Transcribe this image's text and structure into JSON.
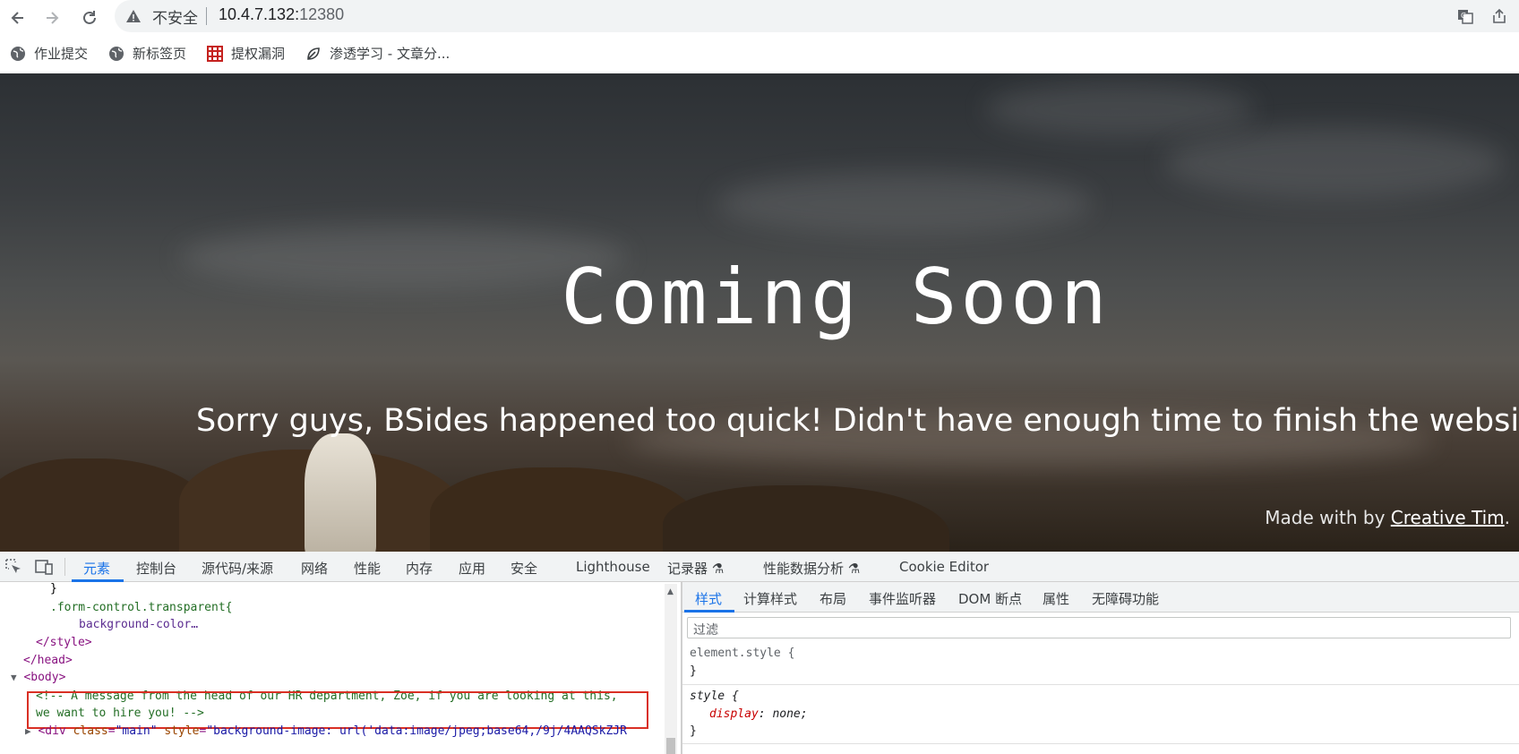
{
  "browser": {
    "nav": {
      "back_icon": "back-arrow-icon",
      "forward_icon": "forward-arrow-icon",
      "reload_icon": "reload-icon"
    },
    "security_label": "不安全",
    "url_host": "10.4.7.132:",
    "url_port": "12380",
    "bookmarks": [
      {
        "label": "作业提交",
        "icon": "globe-icon"
      },
      {
        "label": "新标签页",
        "icon": "globe-icon"
      },
      {
        "label": "提权漏洞",
        "icon": "grid-icon"
      },
      {
        "label": "渗透学习 - 文章分...",
        "icon": "leaf-icon"
      }
    ]
  },
  "page": {
    "title": "Coming Soon",
    "subtitle": "Sorry guys, BSides happened too quick! Didn't have enough time to finish the website.",
    "credit_prefix": "Made with by ",
    "credit_link": "Creative Tim",
    "credit_suffix": "."
  },
  "devtools": {
    "tabs": [
      "元素",
      "控制台",
      "源代码/来源",
      "网络",
      "性能",
      "内存",
      "应用",
      "安全",
      "Lighthouse",
      "记录器",
      "性能数据分析",
      "Cookie Editor"
    ],
    "active_tab": "元素",
    "elements": {
      "line1": "}",
      "line2": ".form-control.transparent{",
      "line3": "background-color…",
      "line4_tag": "</style>",
      "line5_tag": "</head>",
      "line6_tag": "<body>",
      "comment_line1": "<!-- A message from the head of our HR department, Zoe, if you are looking at this,",
      "comment_line2": "we want to hire you! -->",
      "div_tag_open": "<div ",
      "div_attr1": "class",
      "div_val1": "\"main\"",
      "div_attr2": "style",
      "div_val2": "\"background-image: url('data:image/jpeg;base64,/9j/4AAQSkZJR"
    },
    "styles_tabs": [
      "样式",
      "计算样式",
      "布局",
      "事件监听器",
      "DOM 断点",
      "属性",
      "无障碍功能"
    ],
    "filter_placeholder": "过滤",
    "styles": {
      "rule1_selector": "element.style {",
      "rule1_close": "}",
      "rule2_selector": "style {",
      "rule2_prop": "display",
      "rule2_value": ": none;",
      "rule2_close": "}"
    }
  }
}
